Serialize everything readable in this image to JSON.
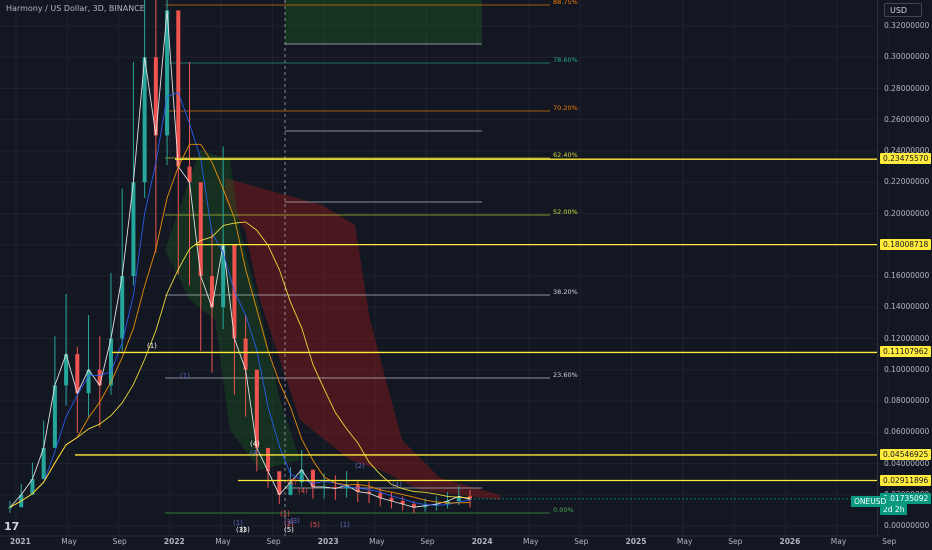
{
  "header": {
    "title": "Harmony / US Dollar, 3D, BINANCE",
    "currency": "USD"
  },
  "symbol_tag": "ONEUSD",
  "chart_data": {
    "type": "line",
    "title": "Harmony / US Dollar, 3D, BINANCE",
    "xlabel": "",
    "ylabel": "",
    "ylim": [
      0.0,
      0.32
    ],
    "y_ticks": [
      "0.32000000",
      "0.30000000",
      "0.28000000",
      "0.26000000",
      "0.24000000",
      "0.22000000",
      "0.20000000",
      "0.18000000",
      "0.16000000",
      "0.14000000",
      "0.12000000",
      "0.10000000",
      "0.08000000",
      "0.06000000",
      "0.04000000",
      "0.02000000",
      "0.00000000"
    ],
    "x_ticks": [
      "2021",
      "May",
      "Sep",
      "2022",
      "May",
      "Sep",
      "2023",
      "May",
      "Sep",
      "2024",
      "May",
      "Sep",
      "2025",
      "May",
      "Sep",
      "2026",
      "May",
      "Sep"
    ],
    "grid": true,
    "horizontal_levels": [
      {
        "label": "0.23475570",
        "value": 0.2347557
      },
      {
        "label": "0.18008718",
        "value": 0.18008718
      },
      {
        "label": "0.11107962",
        "value": 0.11107962
      },
      {
        "label": "0.04546925",
        "value": 0.04546925
      },
      {
        "label": "0.02911896",
        "value": 0.02911896
      }
    ],
    "current_price": {
      "label": "0.01735092",
      "value": 0.01735092,
      "timer": "2d 2h"
    },
    "fib_levels": [
      {
        "label": "88.75%",
        "color": "#f57c00"
      },
      {
        "label": "78.60%",
        "color": "#26a69a"
      },
      {
        "label": "70.20%",
        "color": "#f57c00"
      },
      {
        "label": "62.40%",
        "color": "#cddc39"
      },
      {
        "label": "52.00%",
        "color": "#cddc39"
      },
      {
        "label": "38.20%",
        "color": "#d1d4dc"
      },
      {
        "label": "23.60%",
        "color": "#d1d4dc"
      },
      {
        "label": "0.00%",
        "color": "#4caf50"
      }
    ],
    "wave_labels": [
      "(1)",
      "(1)",
      "(4)",
      "(4)",
      "(2)",
      "(2)",
      "(3)",
      "(4)",
      "(5)",
      "(1)",
      "(2)",
      "(3)",
      "(1)",
      "(5)",
      "(1)",
      "(1)",
      "(4)",
      "(3)"
    ],
    "series": [
      {
        "values": [
          0.012,
          0.02,
          0.03,
          0.05,
          0.09,
          0.11,
          0.085,
          0.1,
          0.09,
          0.12,
          0.16,
          0.22,
          0.3,
          0.25,
          0.33,
          0.23,
          0.22,
          0.16,
          0.14,
          0.18,
          0.12,
          0.1,
          0.05,
          0.035,
          0.02,
          0.028,
          0.036,
          0.025,
          0.025,
          0.024,
          0.026,
          0.022,
          0.021,
          0.018,
          0.016,
          0.014,
          0.012,
          0.013,
          0.014,
          0.016,
          0.019,
          0.017
        ]
      }
    ]
  },
  "colors": {
    "background": "#131722",
    "grid": "#1e222d",
    "level": "#ffeb3b",
    "price_green": "#089981",
    "cloud_red": "#8b1a1a",
    "cloud_green": "#1b5e20"
  }
}
